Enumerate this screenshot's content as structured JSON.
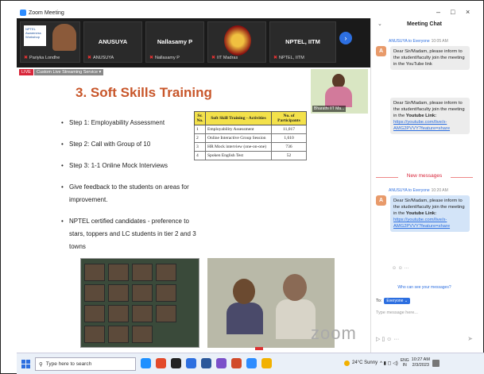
{
  "window": {
    "title": "Zoom Meeting",
    "minimize": "–",
    "maximize": "□",
    "close": "×"
  },
  "strip": {
    "tiles": [
      {
        "name": "Pariyka Londhe",
        "center": ""
      },
      {
        "name": "ANUSUYA",
        "center": "ANUSUYA"
      },
      {
        "name": "Nallasamy P",
        "center": "Nallasamy P"
      },
      {
        "name": "IIT Madras",
        "center": ""
      },
      {
        "name": "NPTEL, IITM",
        "center": "NPTEL, IITM"
      }
    ],
    "arrow": "›"
  },
  "share": {
    "live_label": "LIVE",
    "stream_label": "Custom Live Streaming Service ▾",
    "presenter_label": "Bharathi IIT Ma...",
    "title": "3. Soft Skills Training",
    "bullets": [
      "Step 1: Employability Assessment",
      "Step 2: Call with Group of 10",
      "Step 3: 1-1 Online Mock Interviews",
      "Give feedback to the students on areas for improvement.",
      "NPTEL certified candidates - preference to stars, toppers and LC students in tier 2 and 3 towns"
    ],
    "table": {
      "headers": [
        "Sr. No.",
        "Soft Skill Training - Activities",
        "No. of Participants"
      ],
      "rows": [
        [
          "1",
          "Employability Assessment",
          "11,017"
        ],
        [
          "2",
          "Online Interactive Group Session",
          "1,610"
        ],
        [
          "3",
          "HR Mock interview (one-on-one)",
          "736"
        ],
        [
          "4",
          "Spoken English Test",
          "52"
        ]
      ]
    },
    "watermark": "zoom"
  },
  "chat": {
    "title": "Meeting Chat",
    "chevron": "⌄",
    "msg1": {
      "from": "ANUSUYA to Everyone",
      "time": "10:05 AM",
      "avatar": "A",
      "text": "Dear Sir/Madam, please inform to the student/faculty join the meeting in the YouTube link"
    },
    "msg2": {
      "text_a": "Dear Sir/Madam, please inform to the student/faculty join the meeting in the ",
      "bold": "Youtube Link:",
      "link": "https://youtube.com/live/x-AMG2PVVY?feature=share"
    },
    "new_messages": "New messages",
    "msg3": {
      "from": "ANUSUYA to Everyone",
      "time": "10:20 AM",
      "avatar": "A",
      "text_a": "Dear Sir/Madam, please inform to the student/faculty join the meeting in the ",
      "bold": "Youtube Link:",
      "link": "https://youtube.com/live/x-AMG2PVVY?feature=share"
    },
    "reactions": "☺ ☺ ···",
    "who_can_see": "Who can see your messages?",
    "to_label": "To:",
    "to_value": "Everyone ⌄",
    "input_placeholder": "Type message here...",
    "tools": "▷ ▯ ☺ ···",
    "send": "➤"
  },
  "taskbar": {
    "search_placeholder": "Type here to search",
    "weather": "24°C Sunny",
    "tray_arrows": "^ ▮ ◻ ◁)",
    "lang_top": "ENG",
    "lang_bot": "IN",
    "time": "10:27 AM",
    "date": "2/3/2023",
    "icon_colors": [
      "#1e90ff",
      "#e34a2a",
      "#222222",
      "#2d6fe0",
      "#2b579a",
      "#7b4fc9",
      "#d14a2a",
      "#2d8cff",
      "#f2b100"
    ]
  }
}
